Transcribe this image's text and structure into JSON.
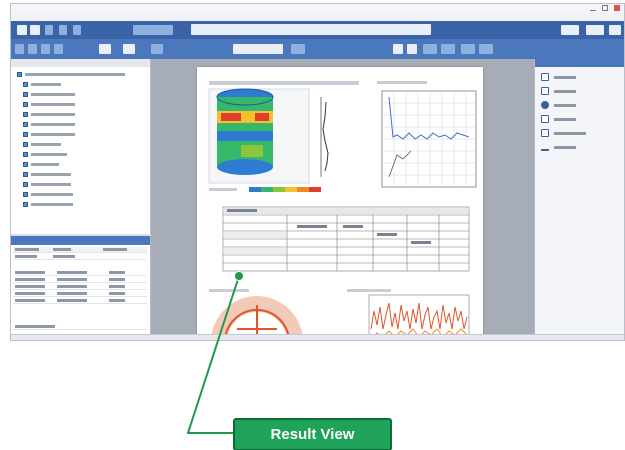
{
  "callout": {
    "label": "Result View",
    "color": "#1fa35a",
    "line_color": "#1f9a4a"
  },
  "app": {
    "ribbon_color": "#3a63a8",
    "viewer_background": "#a7adb6"
  },
  "chart_colors": {
    "cylinder": [
      "#2e7bd1",
      "#36b86a",
      "#f2c230",
      "#e0402b"
    ],
    "spectrum": "#e0552a"
  },
  "icons": {
    "tree": "model-item-icon",
    "right_panel": [
      "view-icon",
      "layer-icon",
      "section-icon",
      "export-icon",
      "measure-icon",
      "report-icon"
    ]
  }
}
